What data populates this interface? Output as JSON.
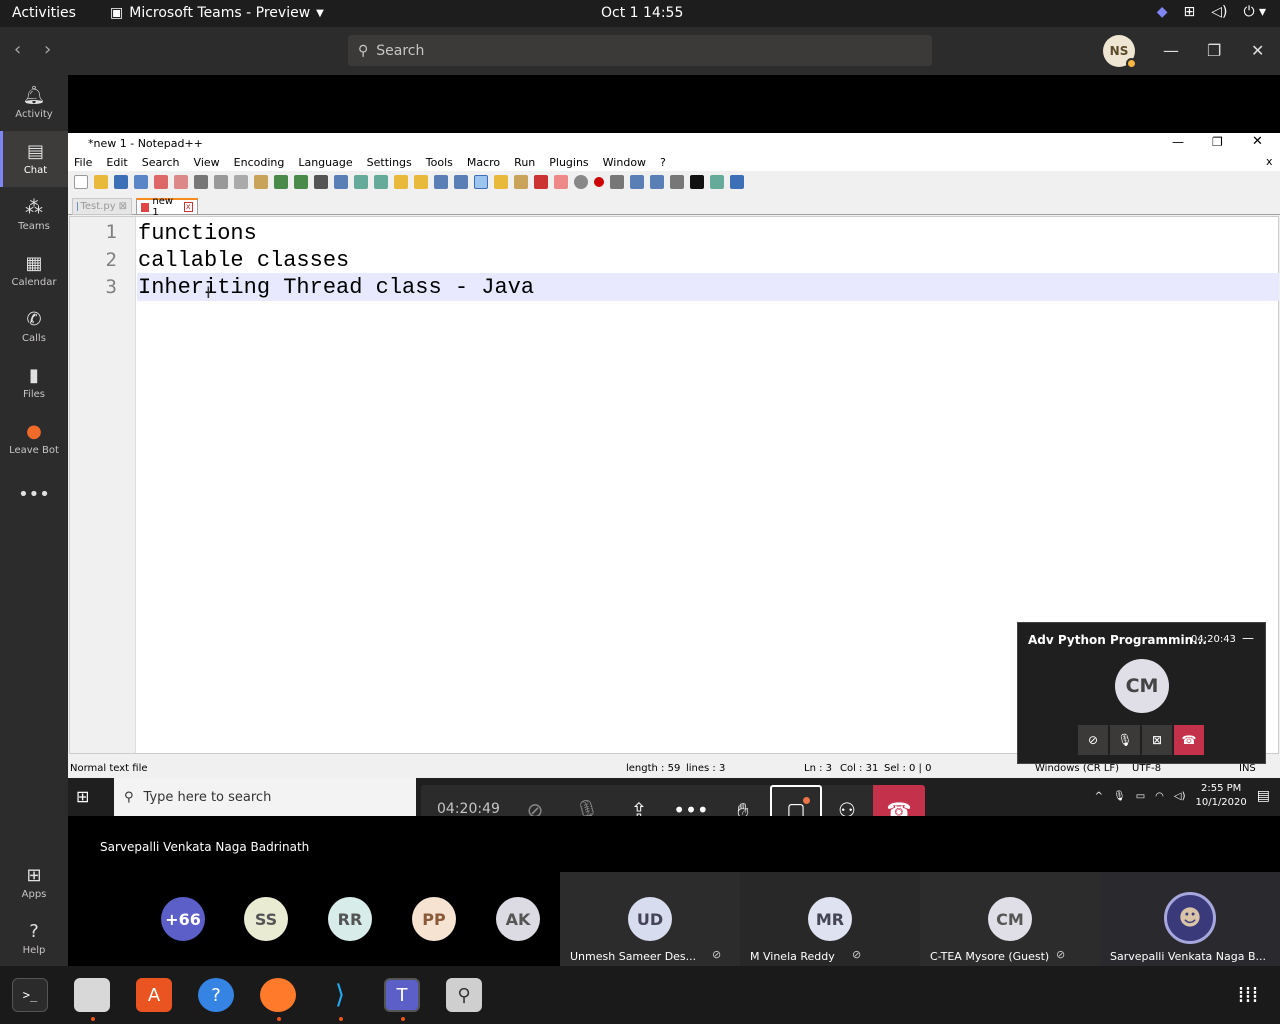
{
  "topbar": {
    "activities": "Activities",
    "app_name": "Microsoft Teams - Preview",
    "clock": "Oct 1  14:55"
  },
  "teams": {
    "search_placeholder": "Search",
    "avatar_initials": "NS",
    "rail": [
      {
        "label": "Activity",
        "icon": "bell-icon"
      },
      {
        "label": "Chat",
        "icon": "chat-icon"
      },
      {
        "label": "Teams",
        "icon": "teams-icon"
      },
      {
        "label": "Calendar",
        "icon": "calendar-icon"
      },
      {
        "label": "Calls",
        "icon": "phone-icon"
      },
      {
        "label": "Files",
        "icon": "file-icon"
      },
      {
        "label": "Leave Bot",
        "icon": "leave-bot-icon"
      },
      {
        "label": "Apps",
        "icon": "apps-icon"
      },
      {
        "label": "Help",
        "icon": "help-icon"
      }
    ]
  },
  "npp": {
    "title": "*new 1 - Notepad++",
    "menus": [
      "File",
      "Edit",
      "Search",
      "View",
      "Encoding",
      "Language",
      "Settings",
      "Tools",
      "Macro",
      "Run",
      "Plugins",
      "Window",
      "?"
    ],
    "tabs": [
      {
        "label": "Test.py",
        "active": false
      },
      {
        "label": "new 1",
        "active": true
      }
    ],
    "lines": [
      {
        "num": "1",
        "text": "functions"
      },
      {
        "num": "2",
        "text": "callable classes"
      },
      {
        "num": "3",
        "text": "Inheriting Thread class - Java"
      }
    ],
    "status": {
      "filetype": "Normal text file",
      "length": "length : 59",
      "lines": "lines : 3",
      "ln": "Ln : 3",
      "col": "Col : 31",
      "sel": "Sel : 0 | 0",
      "eol": "Windows (CR LF)",
      "encoding": "UTF-8",
      "mode": "INS"
    }
  },
  "windows_taskbar": {
    "search_placeholder": "Type here to search",
    "time": "2:55 PM",
    "date": "10/1/2020"
  },
  "meeting": {
    "timer": "04:20:49",
    "presenter": "Sarvepalli Venkata Naga Badrinath",
    "mini": {
      "title": "Adv Python Programmin...",
      "time": "04:20:43",
      "initials": "CM"
    },
    "overflow": "+66",
    "small_avatars": [
      "SS",
      "RR",
      "PP",
      "AK"
    ],
    "tiles": [
      {
        "initials": "UD",
        "name": "Unmesh Sameer Des..."
      },
      {
        "initials": "MR",
        "name": "M Vinela Reddy"
      },
      {
        "initials": "CM",
        "name": "C-TEA Mysore (Guest)"
      },
      {
        "initials": "",
        "name": "Sarvepalli Venkata Naga B..."
      }
    ]
  },
  "colors": {
    "teams_purple": "#6264a7",
    "hangup_red": "#c4314b",
    "npp_tab_orange": "#f58c1b"
  }
}
